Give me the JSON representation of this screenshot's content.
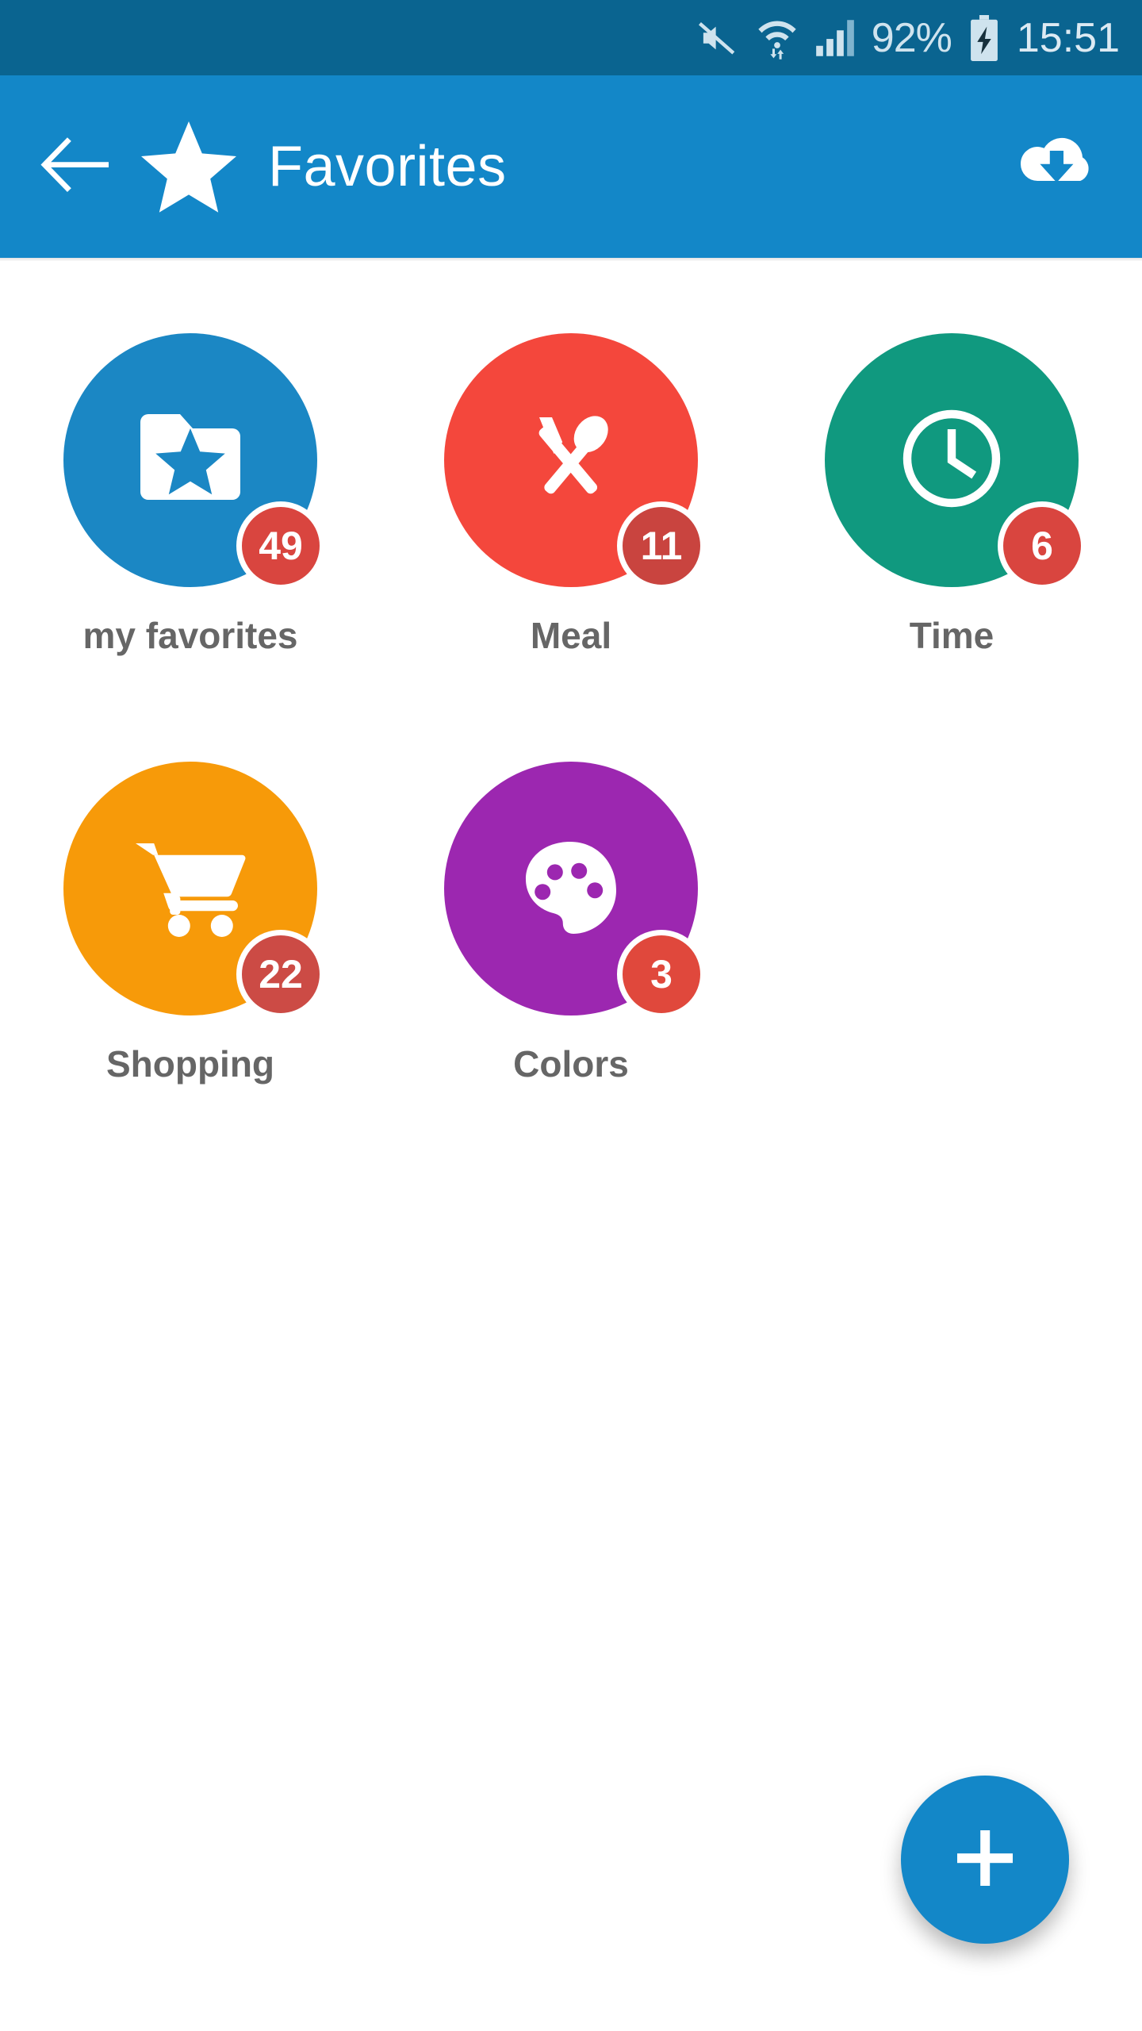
{
  "statusbar": {
    "sound_icon": "mute-icon",
    "wifi_icon": "wifi-transfer-icon",
    "signal_icon": "cellular-signal-icon",
    "battery_percent": "92%",
    "battery_icon": "battery-charging-icon",
    "time": "15:51"
  },
  "appbar": {
    "back_icon": "back-arrow-icon",
    "brand_icon": "star-icon",
    "title": "Favorites",
    "action_icon": "cloud-download-icon"
  },
  "grid": {
    "items": [
      {
        "label": "my favorites",
        "badge": "49",
        "icon": "folder-star-icon",
        "color": "#1b87c4",
        "badge_color": "#d9453f"
      },
      {
        "label": "Meal",
        "badge": "11",
        "icon": "cutlery-icon",
        "color": "#f4473c",
        "badge_color": "#c9443f"
      },
      {
        "label": "Time",
        "badge": "6",
        "icon": "clock-icon",
        "color": "#10997f",
        "badge_color": "#d9453f"
      },
      {
        "label": "Shopping",
        "badge": "22",
        "icon": "shopping-cart-icon",
        "color": "#f79a09",
        "badge_color": "#cc4b45"
      },
      {
        "label": "Colors",
        "badge": "3",
        "icon": "palette-icon",
        "color": "#9c27b0",
        "badge_color": "#e0483c"
      }
    ]
  },
  "fab": {
    "icon": "plus-icon",
    "label": "+",
    "color": "#1387c8"
  },
  "colors": {
    "statusbar_bg": "#0a6490",
    "appbar_bg": "#1387c8",
    "page_bg": "#ffffff",
    "label_text": "#666666"
  }
}
